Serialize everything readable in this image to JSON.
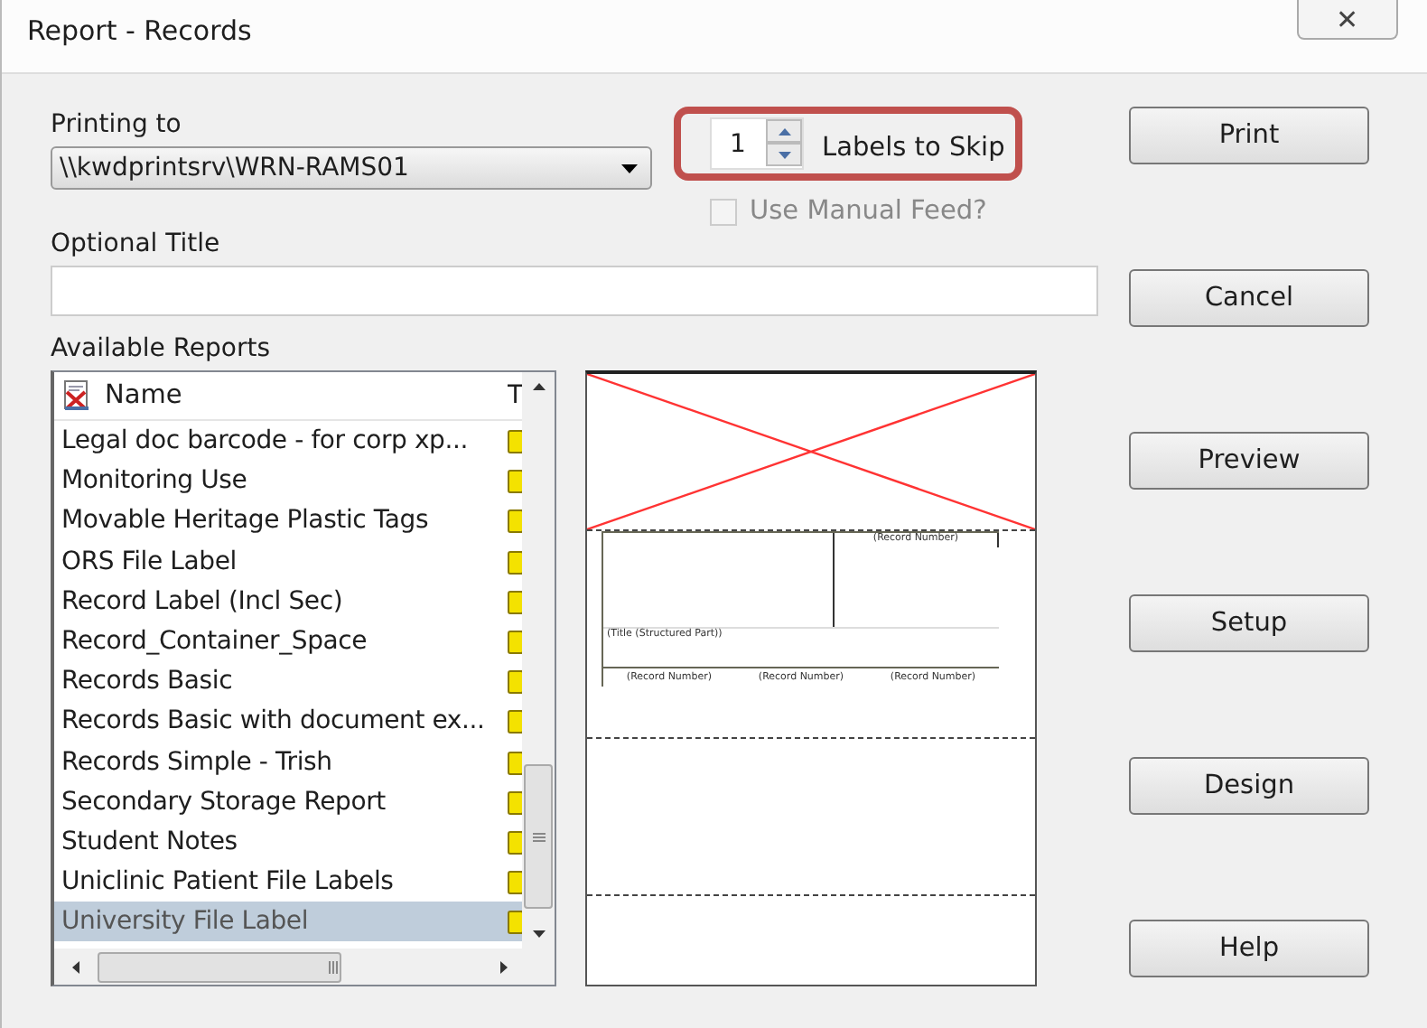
{
  "window": {
    "title": "Report - Records",
    "close": "✕"
  },
  "printing_to": {
    "label": "Printing to",
    "value": "\\\\kwdprintsrv\\WRN-RAMS01"
  },
  "labels_to_skip": {
    "value": "1",
    "label": "Labels to Skip"
  },
  "manual_feed": {
    "label": "Use Manual Feed?",
    "checked": false,
    "disabled": true
  },
  "optional_title": {
    "label": "Optional Title"
  },
  "available_reports": {
    "label": "Available Reports",
    "columns": [
      "Name",
      "T"
    ],
    "rows": [
      {
        "name": "Legal doc barcode - for corp xp...",
        "selected": false
      },
      {
        "name": "Monitoring Use",
        "selected": false
      },
      {
        "name": "Movable Heritage Plastic Tags",
        "selected": false
      },
      {
        "name": "ORS File Label",
        "selected": false
      },
      {
        "name": "Record Label (Incl Sec)",
        "selected": false
      },
      {
        "name": "Record_Container_Space",
        "selected": false
      },
      {
        "name": "Records Basic",
        "selected": false
      },
      {
        "name": "Records Basic with document ex...",
        "selected": false
      },
      {
        "name": "Records Simple - Trish",
        "selected": false
      },
      {
        "name": "Secondary Storage Report",
        "selected": false
      },
      {
        "name": "Student Notes",
        "selected": false
      },
      {
        "name": "Uniclinic Patient File Labels",
        "selected": false
      },
      {
        "name": "University File Label",
        "selected": true
      }
    ]
  },
  "preview": {
    "top_right": "(Record Number)",
    "title_line": "(Title (Structured Part))",
    "bottom": [
      "(Record Number)",
      "(Record Number)",
      "(Record Number)"
    ]
  },
  "buttons": [
    "Print",
    "Cancel",
    "Preview",
    "Setup",
    "Design",
    "Help"
  ]
}
